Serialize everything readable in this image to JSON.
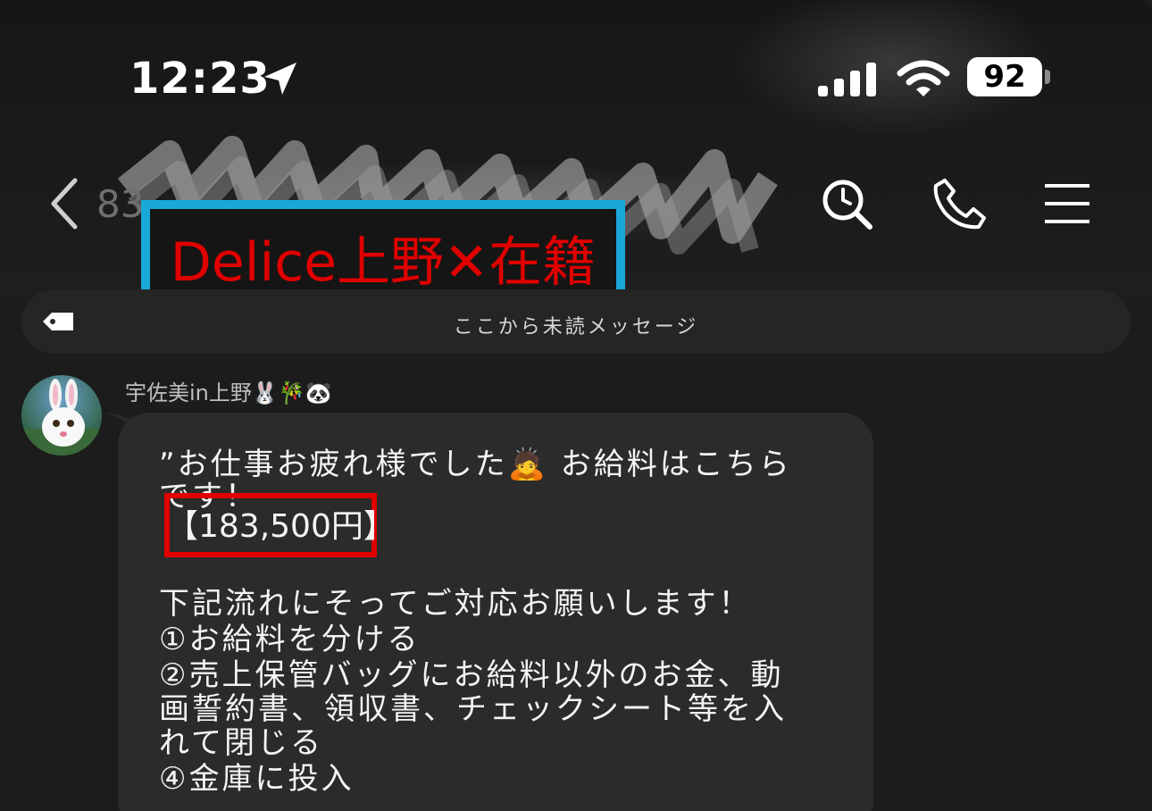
{
  "status_bar": {
    "time": "12:23",
    "battery": "92"
  },
  "header": {
    "back_count": "83",
    "title": "Delice上野✕在籍"
  },
  "unread_bar": {
    "label": "ここから未読メッセージ"
  },
  "message": {
    "sender": "宇佐美in上野🐰🎋🐼",
    "lines": [
      "”お仕事お疲れ様でした🙇 お給料はこちら",
      "です！",
      "【183,500円】",
      "",
      "下記流れにそってご対応お願いします！",
      "①お給料を分ける",
      "②売上保管バッグにお給料以外のお金、動",
      "画誓約書、領収書、チェックシート等を入",
      "れて閉じる",
      "④金庫に投入"
    ]
  },
  "colors": {
    "title_box_border": "#1aa8d8",
    "title_text": "#e00000",
    "highlight_box": "#e00000"
  },
  "icons": [
    "location-arrow-icon",
    "signal-icon",
    "wifi-icon",
    "battery-icon",
    "back-chevron-icon",
    "search-icon",
    "phone-icon",
    "menu-icon",
    "tag-icon"
  ]
}
